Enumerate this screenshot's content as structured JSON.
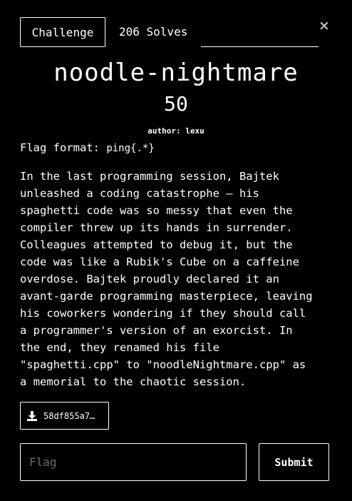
{
  "modal": {
    "close_label": "×"
  },
  "tabs": {
    "challenge_label": "Challenge",
    "solves_label": "206 Solves"
  },
  "challenge": {
    "name": "noodle-nightmare",
    "points": "50",
    "author": "author: lexu",
    "flag_format_label": "Flag format: ",
    "flag_format_value": "ping{.*}",
    "description_lines": [
      "In the last programming session, Bajtek",
      "unleashed a coding catastrophe – his",
      "spaghetti code was so messy that even the",
      "compiler threw up its hands in surrender.",
      "Colleagues attempted to debug it, but the",
      "code was like a Rubik's Cube on a caffeine",
      "overdose. Bajtek proudly declared it an",
      "avant-garde programming masterpiece, leaving",
      "his coworkers wondering if they should call",
      "a programmer's version of an exorcist. In",
      "the end, they renamed his file",
      "\"spaghetti.cpp\" to \"noodleNightmare.cpp\" as",
      "a memorial to the chaotic session."
    ],
    "file_label": "58df855a7…",
    "file_icon": "download-icon"
  },
  "submission": {
    "flag_placeholder": "Flag",
    "flag_value": "",
    "submit_label": "Submit"
  }
}
